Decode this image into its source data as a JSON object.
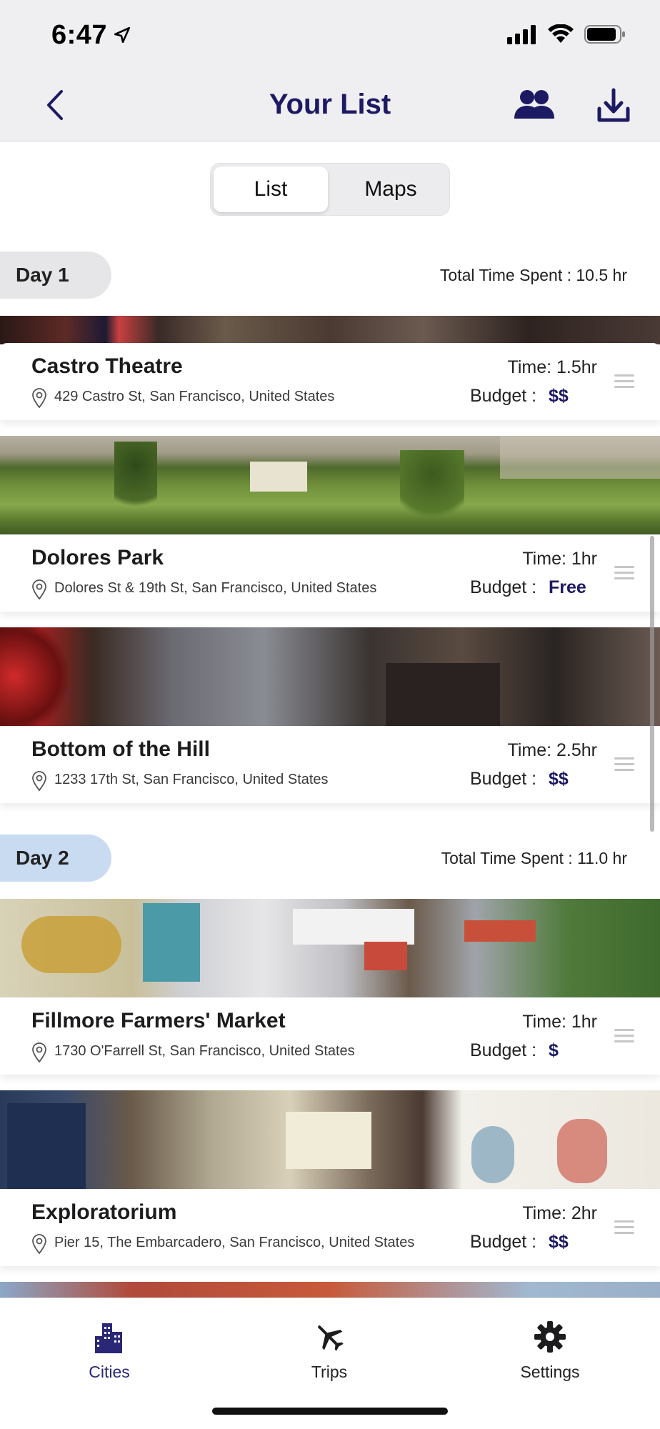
{
  "status_bar": {
    "time": "6:47"
  },
  "nav": {
    "title": "Your List"
  },
  "segment": {
    "list_label": "List",
    "maps_label": "Maps",
    "selected": "List"
  },
  "days": [
    {
      "label": "Day 1",
      "total_time": "Total Time Spent : 10.5 hr",
      "places": [
        {
          "name": "Castro Theatre",
          "address": "429 Castro St, San Francisco, United States",
          "time": "Time: 1.5hr",
          "budget_label": "Budget :",
          "budget": "$$"
        },
        {
          "name": "Dolores Park",
          "address": "Dolores St & 19th St, San Francisco, United States",
          "time": "Time: 1hr",
          "budget_label": "Budget :",
          "budget": "Free"
        },
        {
          "name": "Bottom of the Hill",
          "address": "1233 17th St, San Francisco, United States",
          "time": "Time: 2.5hr",
          "budget_label": "Budget :",
          "budget": "$$"
        }
      ]
    },
    {
      "label": "Day 2",
      "total_time": "Total Time Spent : 11.0 hr",
      "places": [
        {
          "name": "Fillmore Farmers' Market",
          "address": "1730 O'Farrell St, San Francisco, United States",
          "time": "Time: 1hr",
          "budget_label": "Budget :",
          "budget": "$"
        },
        {
          "name": "Exploratorium",
          "address": "Pier 15, The Embarcadero, San Francisco, United States",
          "time": "Time: 2hr",
          "budget_label": "Budget :",
          "budget": "$$"
        }
      ]
    }
  ],
  "tabbar": {
    "items": [
      {
        "label": "Cities",
        "icon": "city-buildings-icon",
        "selected": true
      },
      {
        "label": "Trips",
        "icon": "airplane-icon",
        "selected": false
      },
      {
        "label": "Settings",
        "icon": "gear-icon",
        "selected": false
      }
    ]
  },
  "colors": {
    "accent": "#1d1a64",
    "day1_pill": "#e6e6e8",
    "day2_pill": "#c9dbf1",
    "header_bg": "#efeff1"
  }
}
